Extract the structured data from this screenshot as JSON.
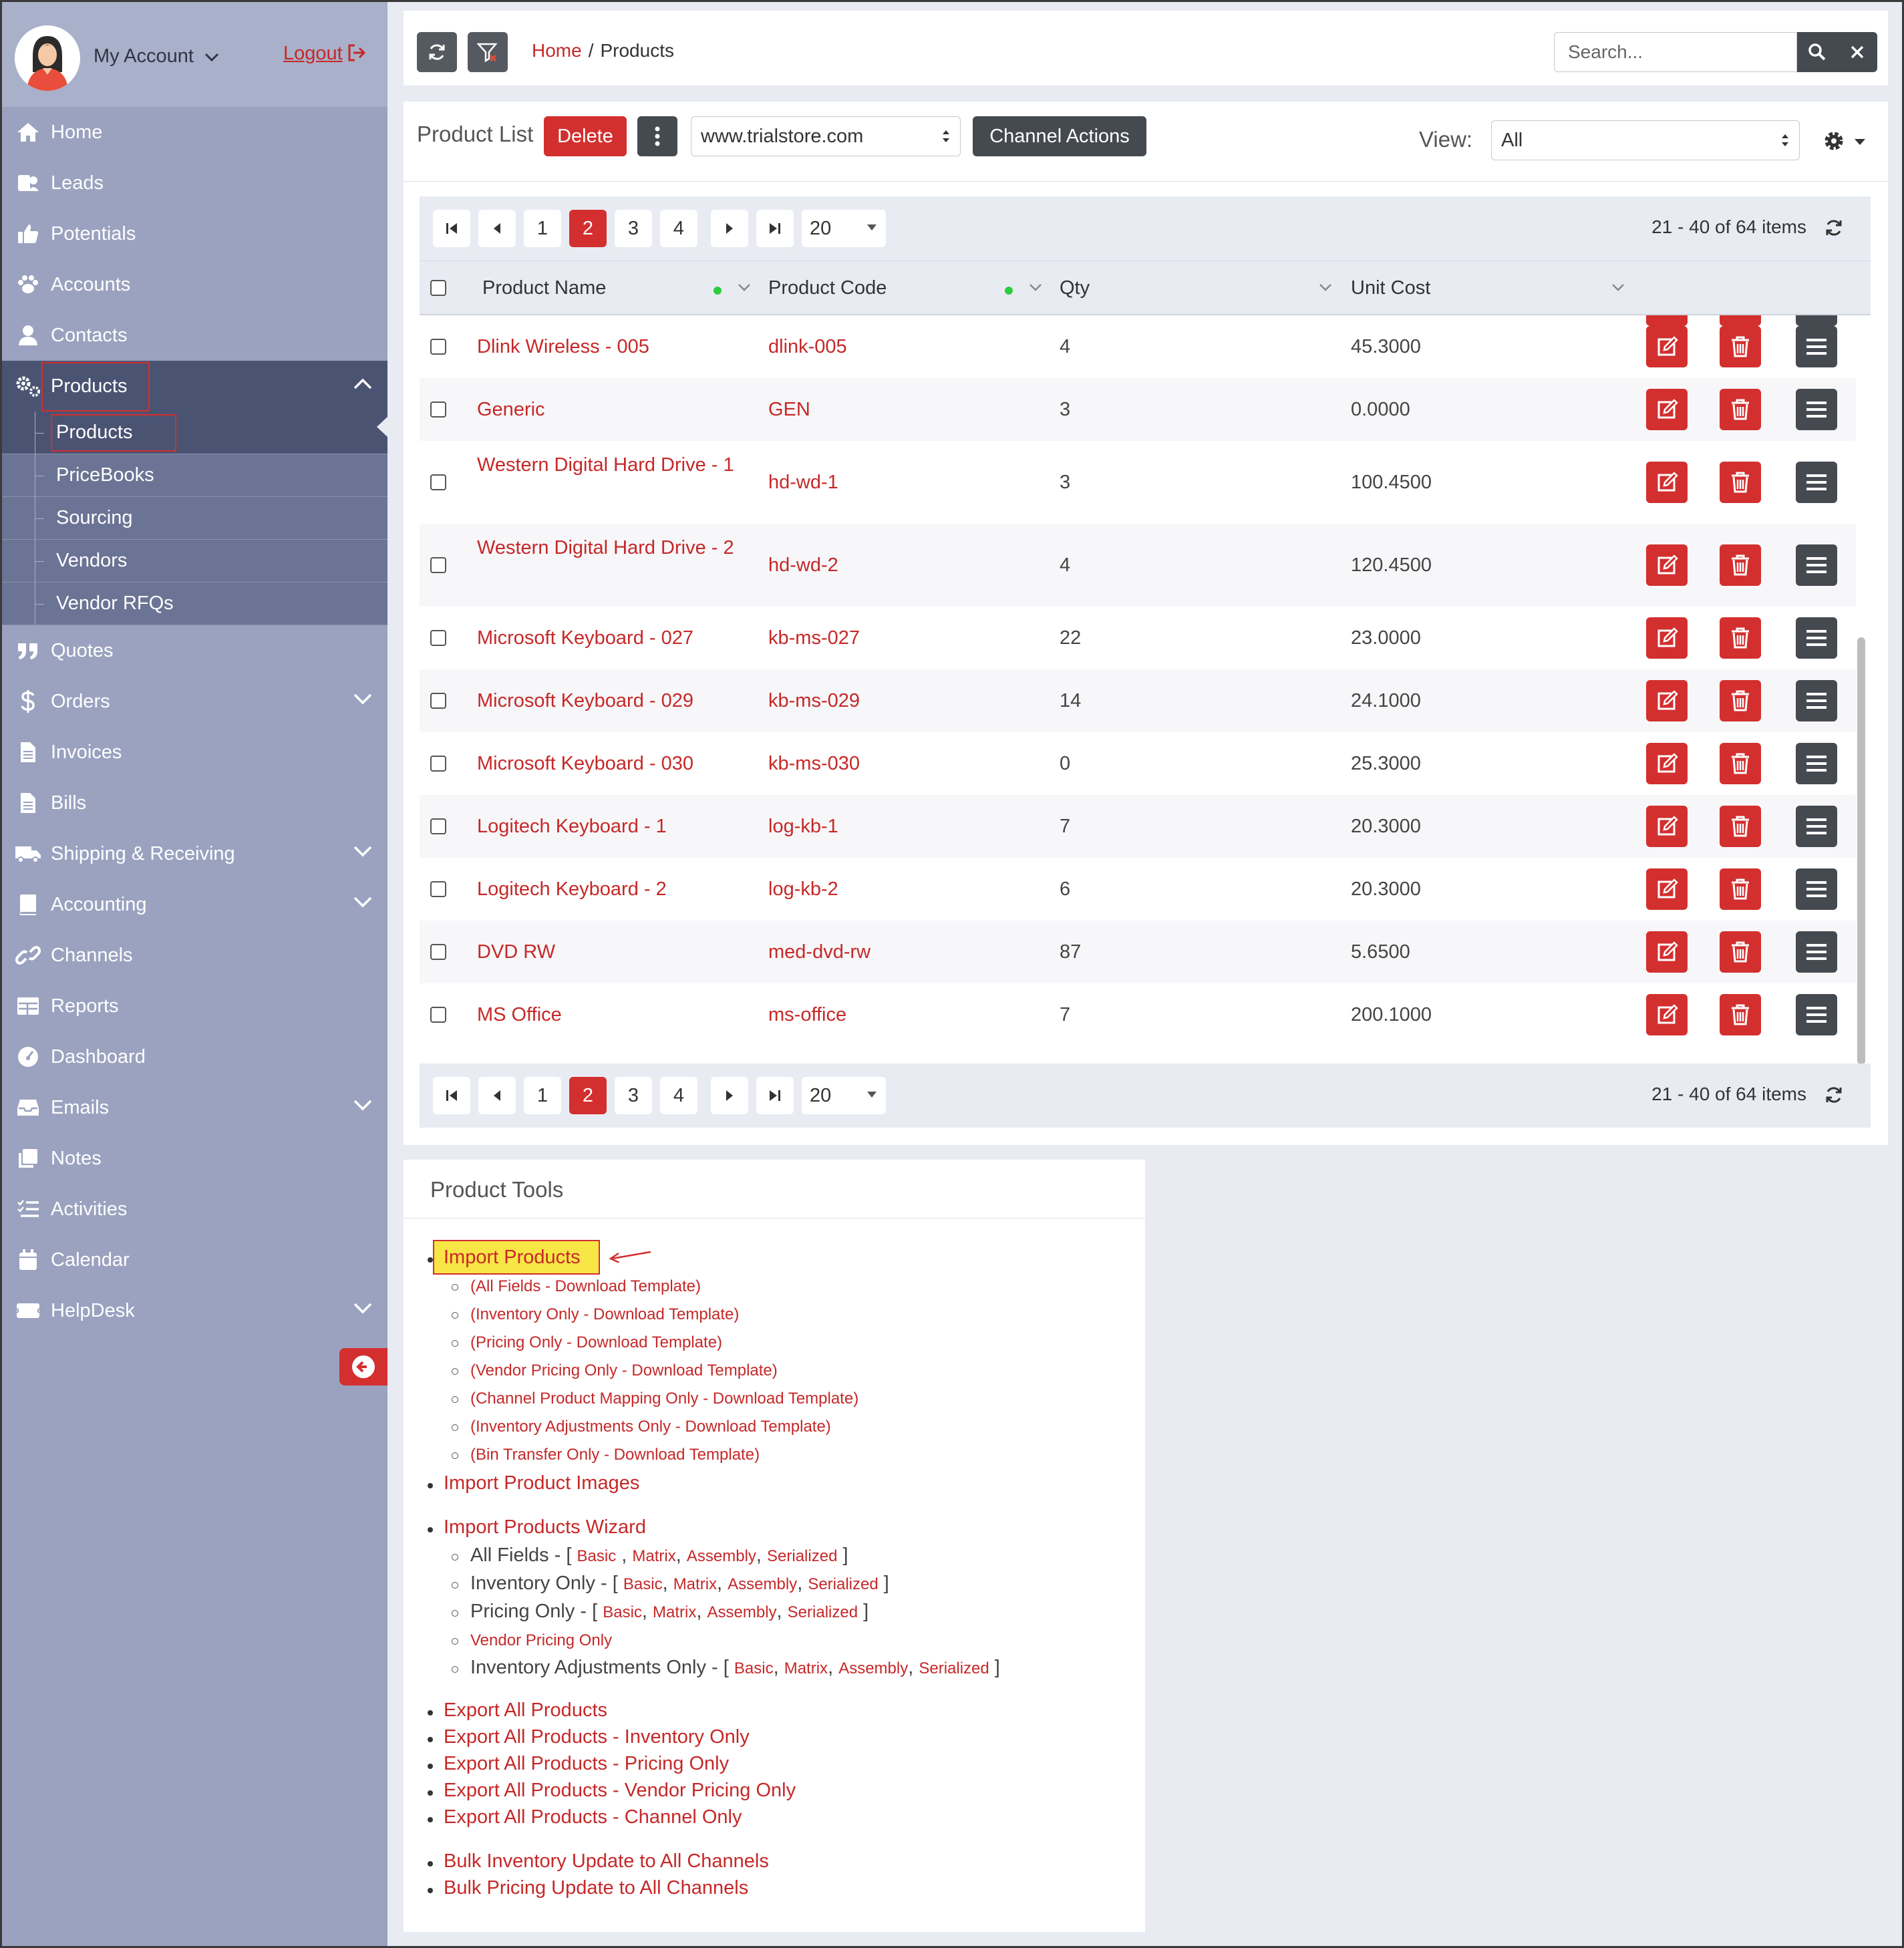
{
  "sidebar": {
    "account": "My Account",
    "logout": "Logout",
    "nav": [
      {
        "label": "Home",
        "icon": "home-icon"
      },
      {
        "label": "Leads",
        "icon": "leads-icon"
      },
      {
        "label": "Potentials",
        "icon": "thumbs-up-icon"
      },
      {
        "label": "Accounts",
        "icon": "paw-icon"
      },
      {
        "label": "Contacts",
        "icon": "user-icon"
      },
      {
        "label": "Products",
        "icon": "gears-icon"
      }
    ],
    "products_sub": [
      "Products",
      "PriceBooks",
      "Sourcing",
      "Vendors",
      "Vendor RFQs"
    ],
    "nav2": [
      {
        "label": "Quotes",
        "icon": "quote-icon"
      },
      {
        "label": "Orders",
        "icon": "dollar-icon"
      },
      {
        "label": "Invoices",
        "icon": "file-icon"
      },
      {
        "label": "Bills",
        "icon": "file-icon"
      },
      {
        "label": "Shipping & Receiving",
        "icon": "truck-icon"
      },
      {
        "label": "Accounting",
        "icon": "book-icon"
      },
      {
        "label": "Channels",
        "icon": "link-icon"
      },
      {
        "label": "Reports",
        "icon": "table-icon"
      },
      {
        "label": "Dashboard",
        "icon": "gauge-icon"
      },
      {
        "label": "Emails",
        "icon": "inbox-icon"
      },
      {
        "label": "Notes",
        "icon": "notes-icon"
      },
      {
        "label": "Activities",
        "icon": "tasks-icon"
      },
      {
        "label": "Calendar",
        "icon": "calendar-icon"
      },
      {
        "label": "HelpDesk",
        "icon": "helpdesk-icon"
      }
    ]
  },
  "topbar": {
    "breadcrumb_home": "Home",
    "breadcrumb_sep": "/",
    "breadcrumb_current": "Products",
    "search_placeholder": "Search..."
  },
  "list": {
    "title": "Product List",
    "delete_label": "Delete",
    "store": "www.trialstore.com",
    "channel_actions": "Channel Actions",
    "view_label": "View:",
    "view_value": "All"
  },
  "pager": {
    "pages": [
      "1",
      "2",
      "3",
      "4"
    ],
    "current_page": "2",
    "page_size": "20",
    "info": "21 - 40 of 64 items"
  },
  "table": {
    "columns": [
      "Product Name",
      "Product Code",
      "Qty",
      "Unit Cost"
    ],
    "rows": [
      {
        "name": "Dlink Wireless - 005",
        "code": "dlink-005",
        "qty": "4",
        "cost": "45.3000"
      },
      {
        "name": "Generic",
        "code": "GEN",
        "qty": "3",
        "cost": "0.0000"
      },
      {
        "name": "Western Digital Hard Drive - 1",
        "code": "hd-wd-1",
        "qty": "3",
        "cost": "100.4500"
      },
      {
        "name": "Western Digital Hard Drive - 2",
        "code": "hd-wd-2",
        "qty": "4",
        "cost": "120.4500"
      },
      {
        "name": "Microsoft Keyboard - 027",
        "code": "kb-ms-027",
        "qty": "22",
        "cost": "23.0000"
      },
      {
        "name": "Microsoft Keyboard - 029",
        "code": "kb-ms-029",
        "qty": "14",
        "cost": "24.1000"
      },
      {
        "name": "Microsoft Keyboard - 030",
        "code": "kb-ms-030",
        "qty": "0",
        "cost": "25.3000"
      },
      {
        "name": "Logitech Keyboard - 1",
        "code": "log-kb-1",
        "qty": "7",
        "cost": "20.3000"
      },
      {
        "name": "Logitech Keyboard - 2",
        "code": "log-kb-2",
        "qty": "6",
        "cost": "20.3000"
      },
      {
        "name": "DVD RW",
        "code": "med-dvd-rw",
        "qty": "87",
        "cost": "5.6500"
      },
      {
        "name": "MS Office",
        "code": "ms-office",
        "qty": "7",
        "cost": "200.1000"
      }
    ]
  },
  "tools": {
    "title": "Product Tools",
    "import_products": "Import Products",
    "templates": [
      "(All Fields - Download Template)",
      "(Inventory Only - Download Template)",
      "(Pricing Only - Download Template)",
      "(Vendor Pricing Only - Download Template)",
      "(Channel Product Mapping Only - Download Template)",
      "(Inventory Adjustments Only - Download Template)",
      "(Bin Transfer Only - Download Template)"
    ],
    "import_images": "Import Product Images",
    "wizard": "Import Products Wizard",
    "wizard_rows": [
      {
        "label": "All Fields - ",
        "types": [
          "Basic",
          "Matrix",
          "Assembly",
          "Serialized"
        ]
      },
      {
        "label": "Inventory Only - ",
        "types": [
          "Basic",
          "Matrix",
          "Assembly",
          "Serialized"
        ]
      },
      {
        "label": "Pricing Only - ",
        "types": [
          "Basic",
          "Matrix",
          "Assembly",
          "Serialized"
        ]
      },
      {
        "label": "",
        "types": []
      },
      {
        "label": "Inventory Adjustments Only - ",
        "types": [
          "Basic",
          "Matrix",
          "Assembly",
          "Serialized"
        ]
      }
    ],
    "vendor_pricing_only": "Vendor Pricing Only",
    "exports": [
      "Export All Products",
      "Export All Products - Inventory Only",
      "Export All Products - Pricing Only",
      "Export All Products - Vendor Pricing Only",
      "Export All Products - Channel Only"
    ],
    "bulk": [
      "Bulk Inventory Update to All Channels",
      "Bulk Pricing Update to All Channels"
    ]
  },
  "colors": {
    "accent_red": "#d32f2f",
    "sidebar_bg": "#9aa2bf",
    "sidebar_active": "#4b5372",
    "dark_button": "#454a50",
    "highlight_yellow": "#f7e646"
  }
}
